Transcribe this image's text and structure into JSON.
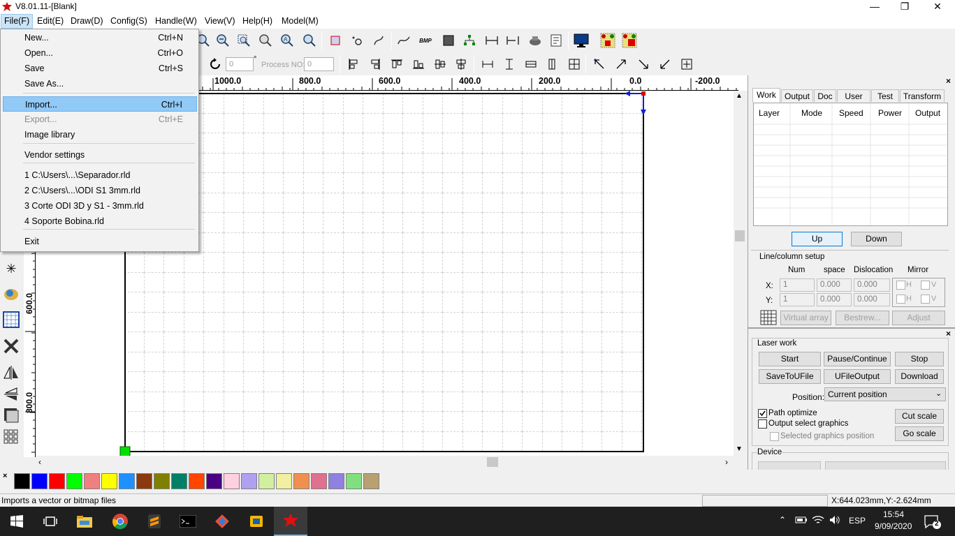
{
  "window": {
    "title": "V8.01.11-[Blank]",
    "minimize": "—",
    "maximize": "❐",
    "close": "✕"
  },
  "menubar": [
    "File(F)",
    "Edit(E)",
    "Draw(D)",
    "Config(S)",
    "Handle(W)",
    "View(V)",
    "Help(H)",
    "Model(M)"
  ],
  "file_menu": {
    "items": [
      {
        "label": "New...",
        "shortcut": "Ctrl+N",
        "state": "normal"
      },
      {
        "label": "Open...",
        "shortcut": "Ctrl+O",
        "state": "normal"
      },
      {
        "label": "Save",
        "shortcut": "Ctrl+S",
        "state": "normal"
      },
      {
        "label": "Save As...",
        "shortcut": "",
        "state": "normal"
      },
      {
        "label": "Import...",
        "shortcut": "Ctrl+I",
        "state": "highlighted"
      },
      {
        "label": "Export...",
        "shortcut": "Ctrl+E",
        "state": "disabled"
      },
      {
        "label": "Image library",
        "shortcut": "",
        "state": "normal"
      },
      {
        "label": "Vendor settings",
        "shortcut": "",
        "state": "normal"
      },
      {
        "label": "1 C:\\Users\\...\\Separador.rld",
        "shortcut": "",
        "state": "normal"
      },
      {
        "label": "2 C:\\Users\\...\\ODI S1 3mm.rld",
        "shortcut": "",
        "state": "normal"
      },
      {
        "label": "3 Corte ODI 3D y S1 - 3mm.rld",
        "shortcut": "",
        "state": "normal"
      },
      {
        "label": "4 Soporte Bobina.rld",
        "shortcut": "",
        "state": "normal"
      },
      {
        "label": "Exit",
        "shortcut": "",
        "state": "normal"
      }
    ]
  },
  "toolbar2": {
    "rotation_value": "0",
    "degree_symbol": "°",
    "process_no_label": "Process NO:",
    "process_no_value": "0"
  },
  "ruler_top": [
    "1000.0",
    "800.0",
    "600.0",
    "400.0",
    "200.0",
    "0.0",
    "-200.0"
  ],
  "ruler_left": [
    "600.0",
    "800.0"
  ],
  "right_panel": {
    "tabs": [
      "Work",
      "Output",
      "Doc",
      "User",
      "Test",
      "Transform"
    ],
    "layer_headers": [
      "Layer",
      "Mode",
      "Speed",
      "Power",
      "Output"
    ],
    "up_label": "Up",
    "down_label": "Down",
    "line_column": {
      "title": "Line/column setup",
      "headers": [
        "Num",
        "space",
        "Dislocation",
        "Mirror"
      ],
      "x_label": "X:",
      "y_label": "Y:",
      "x_values": [
        "1",
        "0.000",
        "0.000"
      ],
      "y_values": [
        "1",
        "0.000",
        "0.000"
      ],
      "mirror_h": "H",
      "mirror_v": "V",
      "virtual_array": "Virtual array",
      "bestrew": "Bestrew...",
      "adjust": "Adjust"
    },
    "laser_work": {
      "title": "Laser work",
      "start": "Start",
      "pause": "Pause/Continue",
      "stop": "Stop",
      "save_to_ufile": "SaveToUFile",
      "ufile_output": "UFileOutput",
      "download": "Download",
      "position_label": "Position:",
      "position_value": "Current position",
      "path_optimize": "Path optimize",
      "output_select": "Output select graphics",
      "selected_position": "Selected graphics position",
      "cut_scale": "Cut scale",
      "go_scale": "Go scale"
    },
    "device_title": "Device"
  },
  "palette": [
    "#000000",
    "#0000ff",
    "#ff0000",
    "#00ff00",
    "#f08080",
    "#ffff00",
    "#1e90ff",
    "#8b3a0f",
    "#808000",
    "#008066",
    "#ff4500",
    "#4b0082",
    "#ffd0e0",
    "#b0a0f0",
    "#d0f0a0",
    "#f0f0a0",
    "#f09050",
    "#e07090",
    "#9080e0",
    "#80e080",
    "#b8a070"
  ],
  "statusbar": {
    "message": "Imports a vector or bitmap files",
    "coords": "X:644.023mm,Y:-2.624mm"
  },
  "taskbar": {
    "language": "ESP",
    "time": "15:54",
    "date": "9/09/2020",
    "notification_count": "2"
  }
}
